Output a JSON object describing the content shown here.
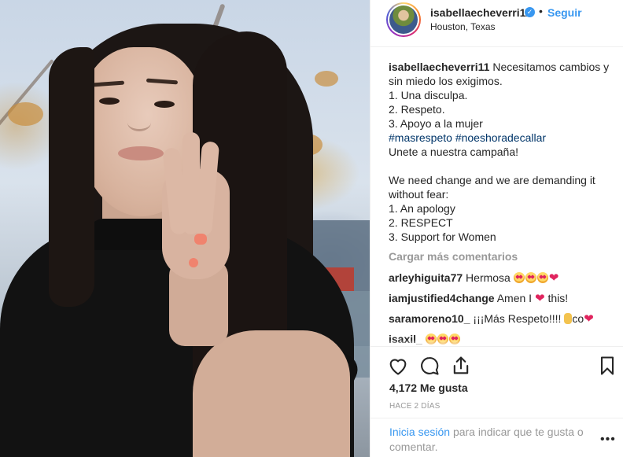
{
  "post": {
    "username": "isabellaecheverri11",
    "verified_mark": "✓",
    "separator": "•",
    "follow_label": "Seguir",
    "location": "Houston, Texas"
  },
  "caption": {
    "user": "isabellaecheverri11",
    "line1": "Necesitamos cambios y",
    "line2": "sin miedo los exigimos.",
    "line3": "1. Una disculpa.",
    "line4": "2. Respeto.",
    "line5": "3. Apoyo a la mujer",
    "hashtag1": "#masrespeto",
    "hashtag2": "#noeshoradecallar",
    "line7": "Unete a nuestra campaña!",
    "line8": "We need change and we are demanding it",
    "line9": "without fear:",
    "line10": "1. An apology",
    "line11": "2. RESPECT",
    "line12": "3. Support for Women"
  },
  "load_more": "Cargar más comentarios",
  "comments": [
    {
      "user": "arleyhiguita77",
      "text": "Hermosa"
    },
    {
      "user": "iamjustified4change",
      "text_before": "Amen I",
      "text_after": "this!"
    },
    {
      "user": "saramoreno10_",
      "text_before": "¡¡¡Más Respeto!!!!",
      "text_after": "co"
    },
    {
      "user": "isaxil_",
      "text": ""
    }
  ],
  "heart_glyph": "❤",
  "likes": "4,172 Me gusta",
  "timestamp": "HACE 2 DÍAS",
  "login": {
    "link": "Inicia sesión",
    "rest": "para indicar que te gusta o comentar."
  },
  "more_glyph": "•••",
  "icons": [
    "heart-icon",
    "comment-icon",
    "share-icon",
    "bookmark-icon",
    "verified-icon"
  ],
  "colors": {
    "link": "#3897f0",
    "hashtag": "#003569",
    "muted": "#999999",
    "text": "#262626"
  }
}
